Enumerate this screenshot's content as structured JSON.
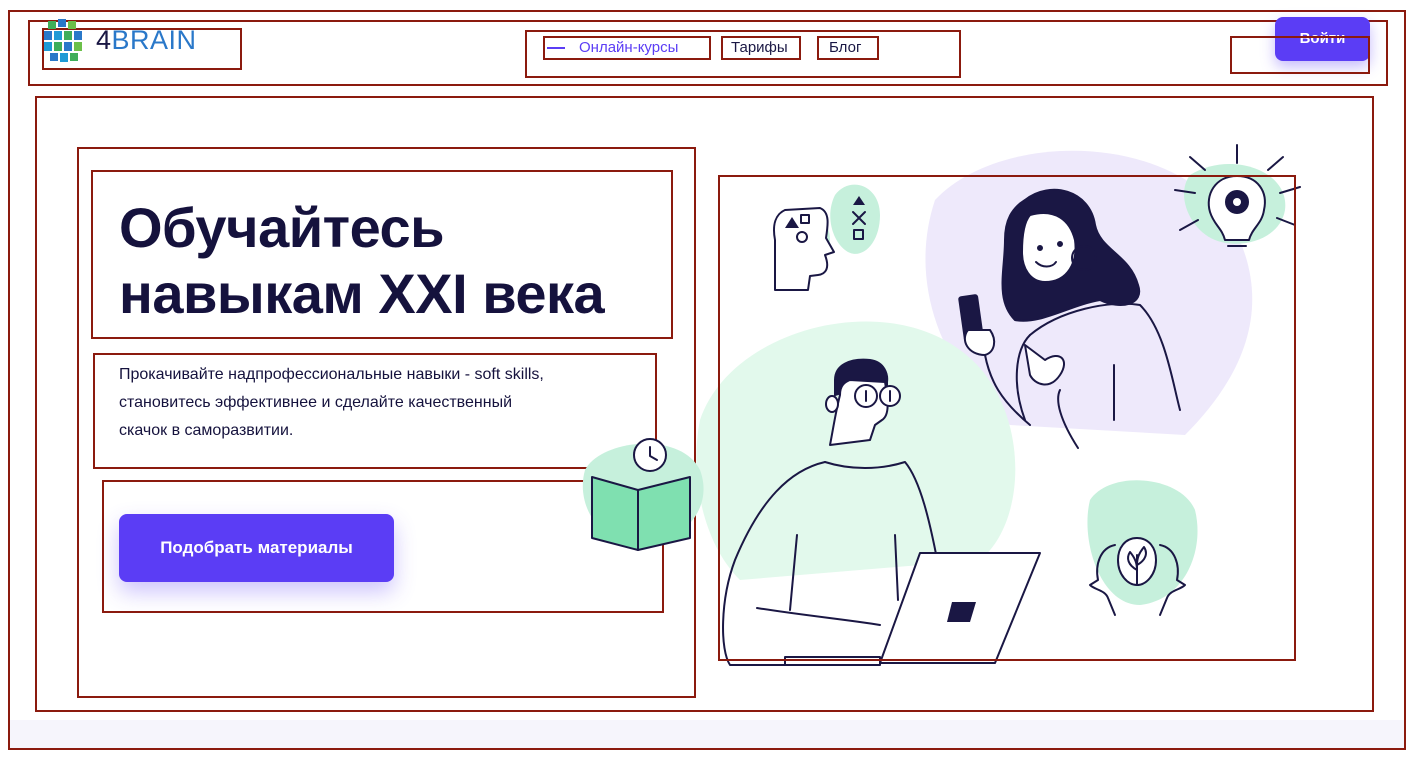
{
  "header": {
    "logo_text_prefix": "4",
    "logo_text_main": "BRAIN",
    "nav": {
      "courses": "Онлайн-курсы",
      "tariffs": "Тарифы",
      "blog": "Блог"
    },
    "login_label": "Войти"
  },
  "hero": {
    "title_line1": "Обучайтесь",
    "title_line2": "навыкам XXI века",
    "description_line1": "Прокачивайте надпрофессиональные навыки - soft skills,",
    "description_line2": "становитесь эффективнее и сделайте качественный",
    "description_line3": "скачок в саморазвитии.",
    "cta_label": "Подобрать материалы"
  },
  "colors": {
    "accent": "#5b3df5",
    "heading": "#15123d",
    "logo_blue": "#2a78c9",
    "illustration_green": "#7fe0b0",
    "illustration_lilac": "#eee9fb"
  }
}
